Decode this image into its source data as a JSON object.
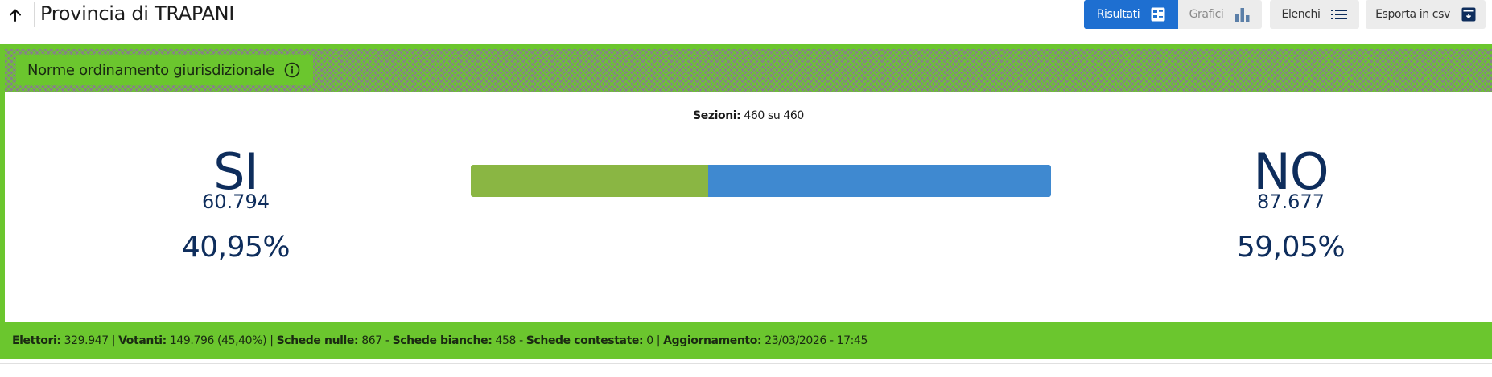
{
  "header": {
    "title": "Provincia di TRAPANI",
    "buttons": {
      "risultati": "Risultati",
      "grafici": "Grafici",
      "elenchi": "Elenchi",
      "esporta": "Esporta in csv"
    }
  },
  "question": {
    "label": "Norme ordinamento giurisdizionale"
  },
  "sezioni": {
    "label": "Sezioni:",
    "value": "460 su 460"
  },
  "results": {
    "si": {
      "label": "SI",
      "votes": "60.794",
      "percent": "40,95%"
    },
    "no": {
      "label": "NO",
      "votes": "87.677",
      "percent": "59,05%"
    }
  },
  "bar": {
    "si_percent": 40.95,
    "no_percent": 59.05
  },
  "footer": {
    "elettori_label": "Elettori:",
    "elettori_value": "329.947",
    "votanti_label": "Votanti:",
    "votanti_value": "149.796 (45,40%)",
    "nulle_label": "Schede nulle:",
    "nulle_value": "867",
    "bianche_label": "Schede bianche:",
    "bianche_value": "458",
    "contestate_label": "Schede contestate:",
    "contestate_value": "0",
    "aggiornamento_label": "Aggiornamento:",
    "aggiornamento_value": "23/03/2026 - 17:45"
  },
  "colors": {
    "accent_green": "#6bc62e",
    "primary_blue": "#1e6fd1",
    "bar_si": "#8ab643",
    "bar_no": "#3f89d0",
    "text_navy": "#0e2d5c"
  },
  "icons": {
    "back": "arrow-up-icon",
    "risultati": "list-detail-icon",
    "grafici": "bar-chart-icon",
    "elenchi": "list-icon",
    "esporta": "archive-download-icon",
    "info": "info-icon"
  }
}
